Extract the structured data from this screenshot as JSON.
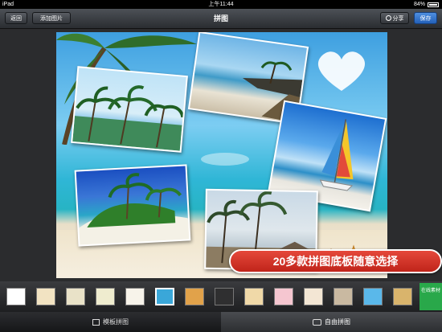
{
  "status": {
    "device": "iPad",
    "time": "上午11:44",
    "battery": "84%"
  },
  "nav": {
    "back_label": "返回",
    "add_label": "添加图片",
    "title": "拼图",
    "share_label": "分享",
    "save_label": "保存"
  },
  "banner": {
    "text": "20多款拼图底板随意选择"
  },
  "thumbnails": [
    {
      "name": "white",
      "color": "#ffffff"
    },
    {
      "name": "cream",
      "color": "#f2e3c2"
    },
    {
      "name": "beige",
      "color": "#e9e2c8"
    },
    {
      "name": "pale-yellow",
      "color": "#efeccf"
    },
    {
      "name": "paper",
      "color": "#f7f3ea"
    },
    {
      "name": "beach",
      "color": "#3aa7d9"
    },
    {
      "name": "stripes",
      "color": "#e1a24a"
    },
    {
      "name": "dark",
      "color": "#2f2f30"
    },
    {
      "name": "sand",
      "color": "#f0d9a8"
    },
    {
      "name": "pink",
      "color": "#f5c6d0"
    },
    {
      "name": "starfish",
      "color": "#f3e6d4"
    },
    {
      "name": "stone",
      "color": "#c9b9a1"
    },
    {
      "name": "sky",
      "color": "#5ab8ea"
    },
    {
      "name": "gold",
      "color": "#d9b46c"
    }
  ],
  "selected_thumbnail": 5,
  "online_badge": "在线素材",
  "tabs": {
    "template_label": "模板拼图",
    "free_label": "自由拼图"
  }
}
